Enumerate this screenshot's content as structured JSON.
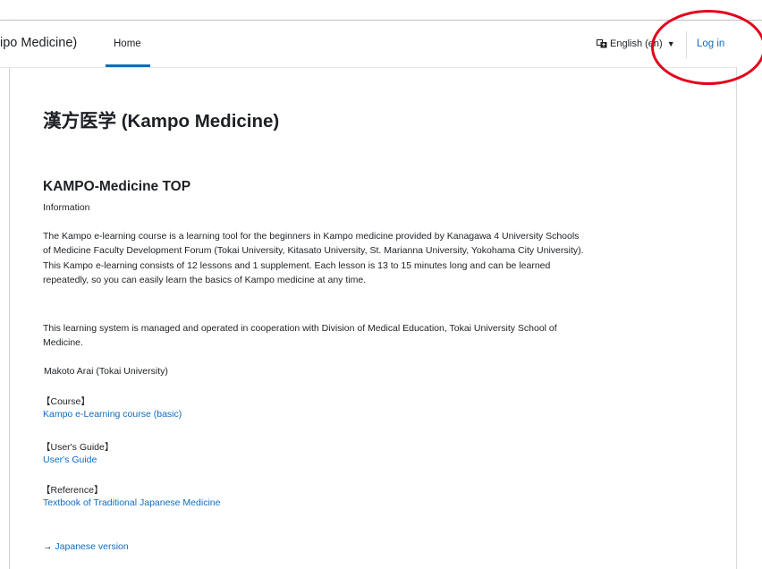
{
  "navbar": {
    "brand": "ipo Medicine)",
    "home_label": "Home",
    "language_label": "English (en)",
    "login_label": "Log in"
  },
  "main": {
    "page_title": "漢方医学 (Kampo Medicine)",
    "section_title": "KAMPO-Medicine TOP",
    "info_label": "Information",
    "paragraph_1": "The Kampo e-learning course is a learning tool for the beginners in Kampo medicine provided by Kanagawa 4 University Schools of Medicine Faculty Development Forum (Tokai University, Kitasato University, St. Marianna University, Yokohama City University). This Kampo e-learning consists of 12 lessons and 1 supplement. Each lesson is 13 to 15 minutes long and can be learned repeatedly, so you can easily learn the basics of Kampo medicine at any time.",
    "paragraph_2": "This learning system is managed and operated in cooperation with Division of Medical Education, Tokai University School of Medicine.",
    "author": "Makoto Arai (Tokai University)",
    "course_heading": "【Course】",
    "course_link": "Kampo e-Learning course (basic)",
    "guide_heading": "【User's Guide】",
    "guide_link": "User's Guide",
    "reference_heading": "【Reference】",
    "reference_link": "Textbook of Traditional Japanese Medicine",
    "japanese_arrow": "→",
    "japanese_link": "Japanese version"
  },
  "colors": {
    "link": "#0f6cbf",
    "annotation": "#e3001b"
  },
  "icons": {
    "language": "translate-icon",
    "dropdown": "chevron-down-icon"
  }
}
